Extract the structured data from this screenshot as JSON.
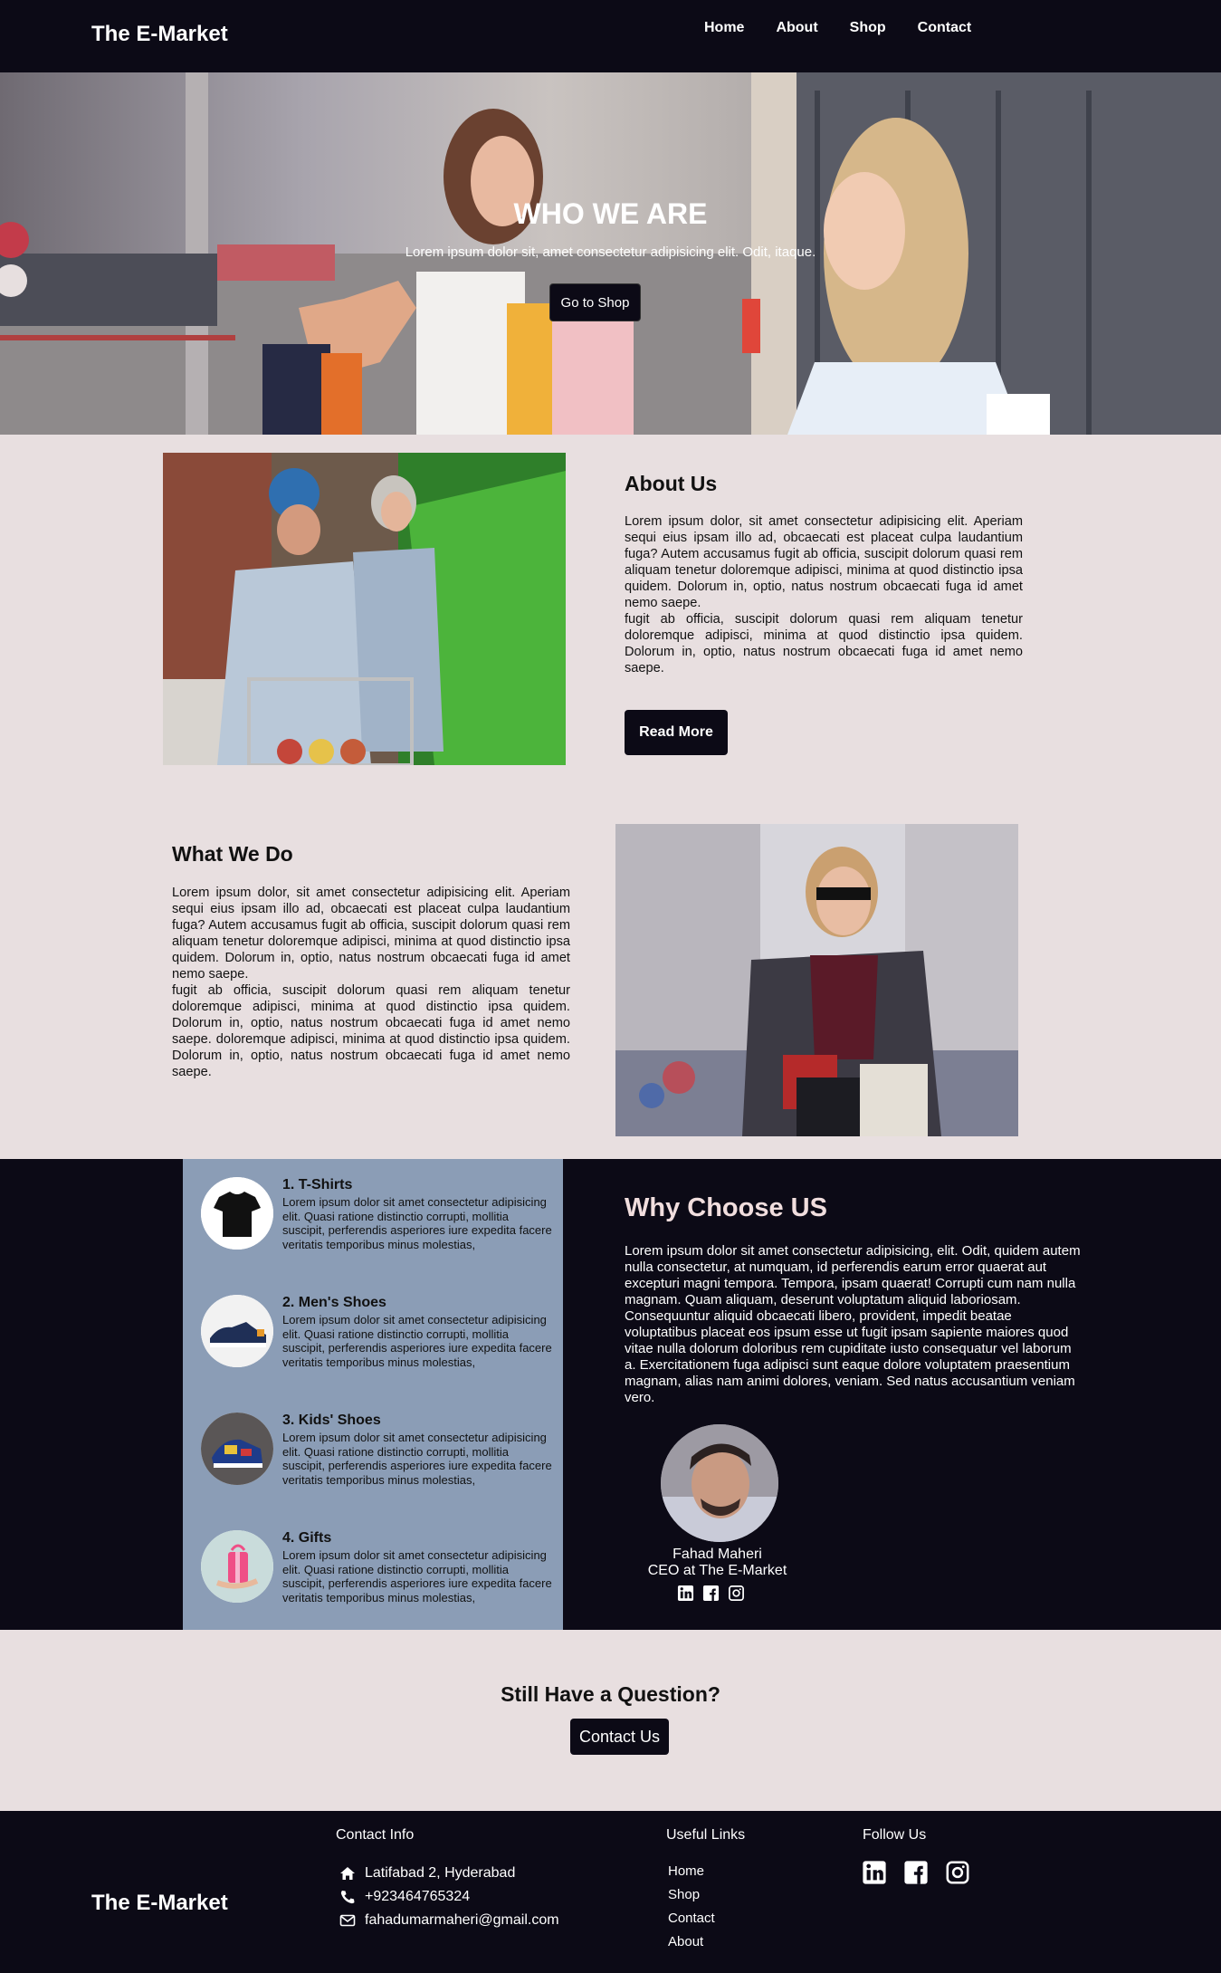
{
  "nav": {
    "brand": "The E-Market",
    "links": [
      "Home",
      "About",
      "Shop",
      "Contact"
    ]
  },
  "hero": {
    "title": "WHO WE ARE",
    "subtitle": "Lorem ipsum dolor sit, amet consectetur adipisicing elit. Odit, itaque.",
    "button": "Go to Shop"
  },
  "about": {
    "title": "About Us",
    "text": "Lorem ipsum dolor, sit amet consectetur adipisicing elit. Aperiam sequi eius ipsam illo ad, obcaecati est placeat culpa laudantium fuga? Autem accusamus fugit ab officia, suscipit dolorum quasi rem aliquam tenetur doloremque adipisci, minima at quod distinctio ipsa quidem. Dolorum in, optio, natus nostrum obcaecati fuga id amet nemo saepe.",
    "text2": "fugit ab officia, suscipit dolorum quasi rem aliquam tenetur doloremque adipisci, minima at quod distinctio ipsa quidem. Dolorum in, optio, natus nostrum obcaecati fuga id amet nemo saepe.",
    "button": "Read More"
  },
  "what": {
    "title": "What We Do",
    "text": "Lorem ipsum dolor, sit amet consectetur adipisicing elit. Aperiam sequi eius ipsam illo ad, obcaecati est placeat culpa laudantium fuga? Autem accusamus fugit ab officia, suscipit dolorum quasi rem aliquam tenetur doloremque adipisci, minima at quod distinctio ipsa quidem. Dolorum in, optio, natus nostrum obcaecati fuga id amet nemo saepe.",
    "text2": "fugit ab officia, suscipit dolorum quasi rem aliquam tenetur doloremque adipisci, minima at quod distinctio ipsa quidem. Dolorum in, optio, natus nostrum obcaecati fuga id amet nemo saepe. doloremque adipisci, minima at quod distinctio ipsa quidem. Dolorum in, optio, natus nostrum obcaecati fuga id amet nemo saepe."
  },
  "products": [
    {
      "title": "1. T-Shirts",
      "desc": "Lorem ipsum dolor sit amet consectetur adipisicing elit. Quasi ratione distinctio corrupti, mollitia suscipit, perferendis asperiores iure expedita facere veritatis temporibus minus molestias,",
      "icon": "tshirt-icon"
    },
    {
      "title": "2. Men's Shoes",
      "desc": "Lorem ipsum dolor sit amet consectetur adipisicing elit. Quasi ratione distinctio corrupti, mollitia suscipit, perferendis asperiores iure expedita facere veritatis temporibus minus molestias,",
      "icon": "shoe-icon"
    },
    {
      "title": "3. Kids' Shoes",
      "desc": "Lorem ipsum dolor sit amet consectetur adipisicing elit. Quasi ratione distinctio corrupti, mollitia suscipit, perferendis asperiores iure expedita facere veritatis temporibus minus molestias,",
      "icon": "kids-shoe-icon"
    },
    {
      "title": "4. Gifts",
      "desc": "Lorem ipsum dolor sit amet consectetur adipisicing elit. Quasi ratione distinctio corrupti, mollitia suscipit, perferendis asperiores iure expedita facere veritatis temporibus minus molestias,",
      "icon": "gift-icon"
    }
  ],
  "why": {
    "title": "Why Choose US",
    "text": "Lorem ipsum dolor sit amet consectetur adipisicing, elit. Odit, quidem autem nulla consectetur, at numquam, id perferendis earum error quaerat aut excepturi magni tempora. Tempora, ipsam quaerat! Corrupti cum nam nulla magnam. Quam aliquam, deserunt voluptatum aliquid laboriosam. Consequuntur aliquid obcaecati libero, provident, impedit beatae voluptatibus placeat eos ipsum esse ut fugit ipsam sapiente maiores quod vitae nulla dolorum doloribus rem cupiditate iusto consequatur vel laborum a. Exercitationem fuga adipisci sunt eaque dolore voluptatem praesentium magnam, alias nam animi dolores, veniam. Sed natus accusantium veniam vero.",
    "ceo_name": "Fahad Maheri",
    "ceo_role": "CEO at The E-Market",
    "social_icons": [
      "linkedin-icon",
      "facebook-icon",
      "instagram-icon"
    ]
  },
  "question": {
    "title": "Still Have a Question?",
    "button": "Contact Us"
  },
  "footer": {
    "brand": "The E-Market",
    "contact_heading": "Contact Info",
    "address": "Latifabad 2, Hyderabad",
    "phone": "+923464765324",
    "email": "fahadumarmaheri@gmail.com",
    "links_heading": "Useful Links",
    "links": [
      "Home",
      "Shop",
      "Contact",
      "About"
    ],
    "follow_heading": "Follow Us"
  },
  "colors": {
    "dark": "#0c0a16",
    "page_bg": "#e8dfe0",
    "products_bg": "#8b9db6",
    "why_title": "#f1dede"
  }
}
